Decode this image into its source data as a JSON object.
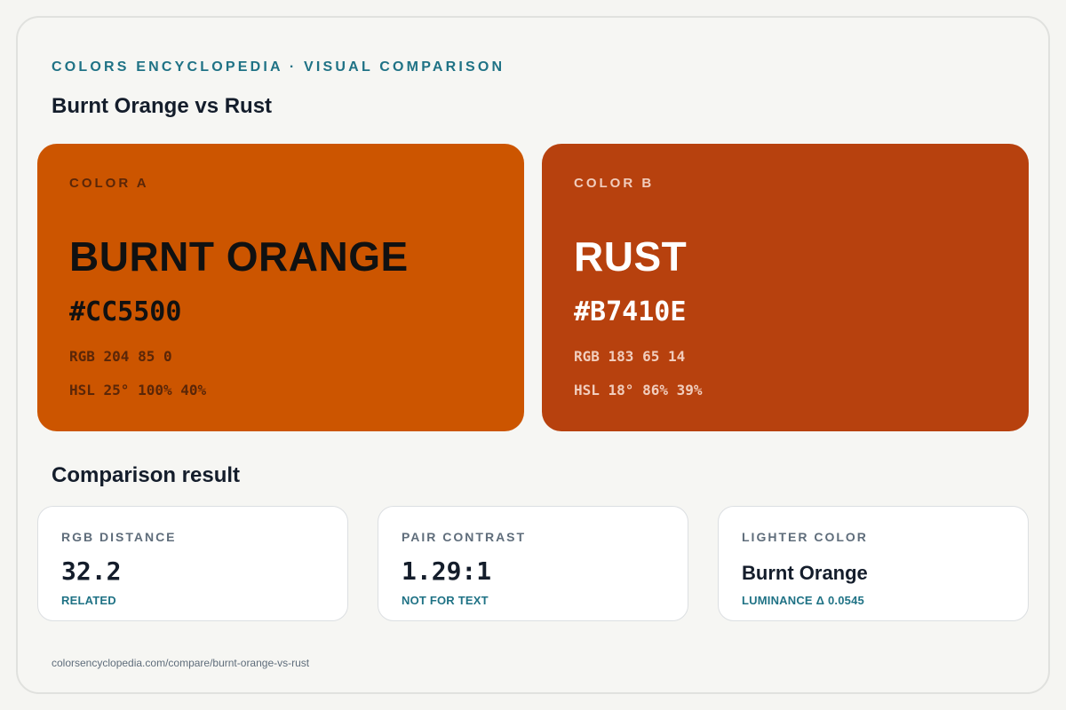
{
  "header": {
    "kicker": "COLORS ENCYCLOPEDIA · VISUAL COMPARISON",
    "title": "Burnt Orange vs Rust"
  },
  "colors": {
    "a": {
      "label": "COLOR A",
      "name": "BURNT ORANGE",
      "hex": "#CC5500",
      "rgb": "RGB 204 85 0",
      "hsl": "HSL 25° 100% 40%",
      "bg": "#CC5500",
      "text_color": "#111111",
      "meta_color": "#5a2608"
    },
    "b": {
      "label": "COLOR B",
      "name": "RUST",
      "hex": "#B7410E",
      "rgb": "RGB 183 65 14",
      "hsl": "HSL 18° 86% 39%",
      "bg": "#B7410E",
      "text_color": "#ffffff",
      "meta_color": "#f1cdbd"
    }
  },
  "comparison": {
    "title": "Comparison result",
    "rgb_distance": {
      "label": "RGB DISTANCE",
      "value": "32.2",
      "note": "RELATED"
    },
    "pair_contrast": {
      "label": "PAIR CONTRAST",
      "value": "1.29:1",
      "note": "NOT FOR TEXT"
    },
    "lighter_color": {
      "label": "LIGHTER COLOR",
      "value": "Burnt Orange",
      "note": "LUMINANCE Δ 0.0545"
    }
  },
  "footer": {
    "url": "colorsencyclopedia.com/compare/burnt-orange-vs-rust"
  }
}
